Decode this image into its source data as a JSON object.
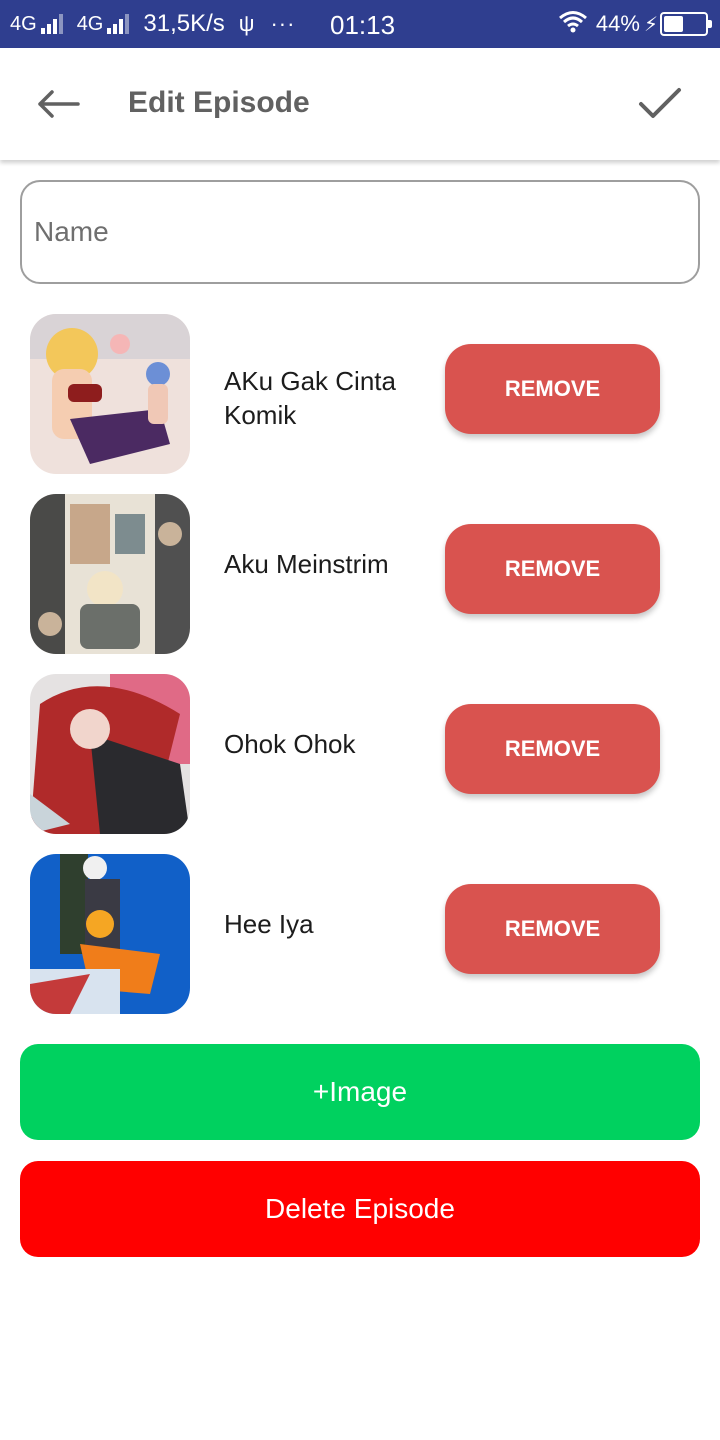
{
  "status_bar": {
    "network1": "4G",
    "network2": "4G",
    "speed": "31,5K/s",
    "usb_icon": "usb-icon",
    "more": "···",
    "time": "01:13",
    "wifi_icon": "wifi-icon",
    "battery_pct": "44%",
    "battery_level": 0.44,
    "charging_icon": "charging-bolt-icon"
  },
  "app_bar": {
    "back_icon": "arrow-left-icon",
    "title": "Edit Episode",
    "confirm_icon": "check-icon"
  },
  "name_field": {
    "placeholder": "Name",
    "value": ""
  },
  "episodes": [
    {
      "title": "AKu Gak Cinta Komik",
      "remove_label": "REMOVE"
    },
    {
      "title": "Aku Meinstrim",
      "remove_label": "REMOVE"
    },
    {
      "title": "Ohok Ohok",
      "remove_label": "REMOVE"
    },
    {
      "title": "Hee Iya",
      "remove_label": "REMOVE"
    }
  ],
  "buttons": {
    "add_image": "+Image",
    "delete_episode": "Delete Episode"
  },
  "colors": {
    "status_bar": "#2f3e8f",
    "remove": "#d9534f",
    "add_image": "#00d15f",
    "delete": "#ff0000"
  }
}
